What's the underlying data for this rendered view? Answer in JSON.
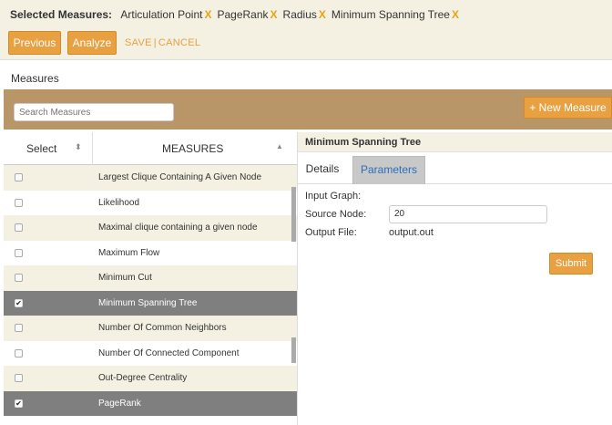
{
  "header": {
    "selected_label": "Selected Measures:",
    "selected": [
      "Articulation Point",
      "PageRank",
      "Radius",
      "Minimum Spanning Tree"
    ],
    "remove_glyph": "X",
    "previous_label": "Previous",
    "analyze_label": "Analyze",
    "save_label": "SAVE",
    "separator": "|",
    "cancel_label": "CANCEL"
  },
  "measures_section": {
    "title": "Measures",
    "search_placeholder": "Search Measures",
    "new_measure_label": "+ New Measure"
  },
  "table": {
    "col_select": "Select",
    "col_measures": "MEASURES",
    "select_sort_icon": "sort-icon",
    "measures_sort_icon": "sort-asc-icon",
    "rows": [
      {
        "name": "Largest Clique Containing A Given Node",
        "checked": false,
        "mark": ""
      },
      {
        "name": "Likelihood",
        "checked": false,
        "mark": ""
      },
      {
        "name": "Maximal clique containing a given node",
        "checked": false,
        "mark": ""
      },
      {
        "name": "Maximum Flow",
        "checked": false,
        "mark": ""
      },
      {
        "name": "Minimum Cut",
        "checked": false,
        "mark": ""
      },
      {
        "name": "Minimum Spanning Tree",
        "checked": true,
        "mark": "✔"
      },
      {
        "name": "Number Of Common Neighbors",
        "checked": false,
        "mark": ""
      },
      {
        "name": "Number Of Connected Component",
        "checked": false,
        "mark": ""
      },
      {
        "name": "Out-Degree Centrality",
        "checked": false,
        "mark": ""
      },
      {
        "name": "PageRank",
        "checked": true,
        "mark": "✔"
      }
    ]
  },
  "detail": {
    "title": "Minimum Spanning Tree",
    "tabs": [
      "Details",
      "Parameters"
    ],
    "active_tab": "Parameters",
    "input_graph_label": "Input Graph:",
    "source_node_label": "Source Node:",
    "source_node_value": "20",
    "output_file_label": "Output File:",
    "output_file_value": "output.out",
    "submit_label": "Submit"
  },
  "colors": {
    "accent": "#e8a041",
    "band": "#b89668",
    "row_alt": "#f4f1e2",
    "row_selected": "#7f7f7f",
    "tab_active_text": "#2a6ebb"
  }
}
